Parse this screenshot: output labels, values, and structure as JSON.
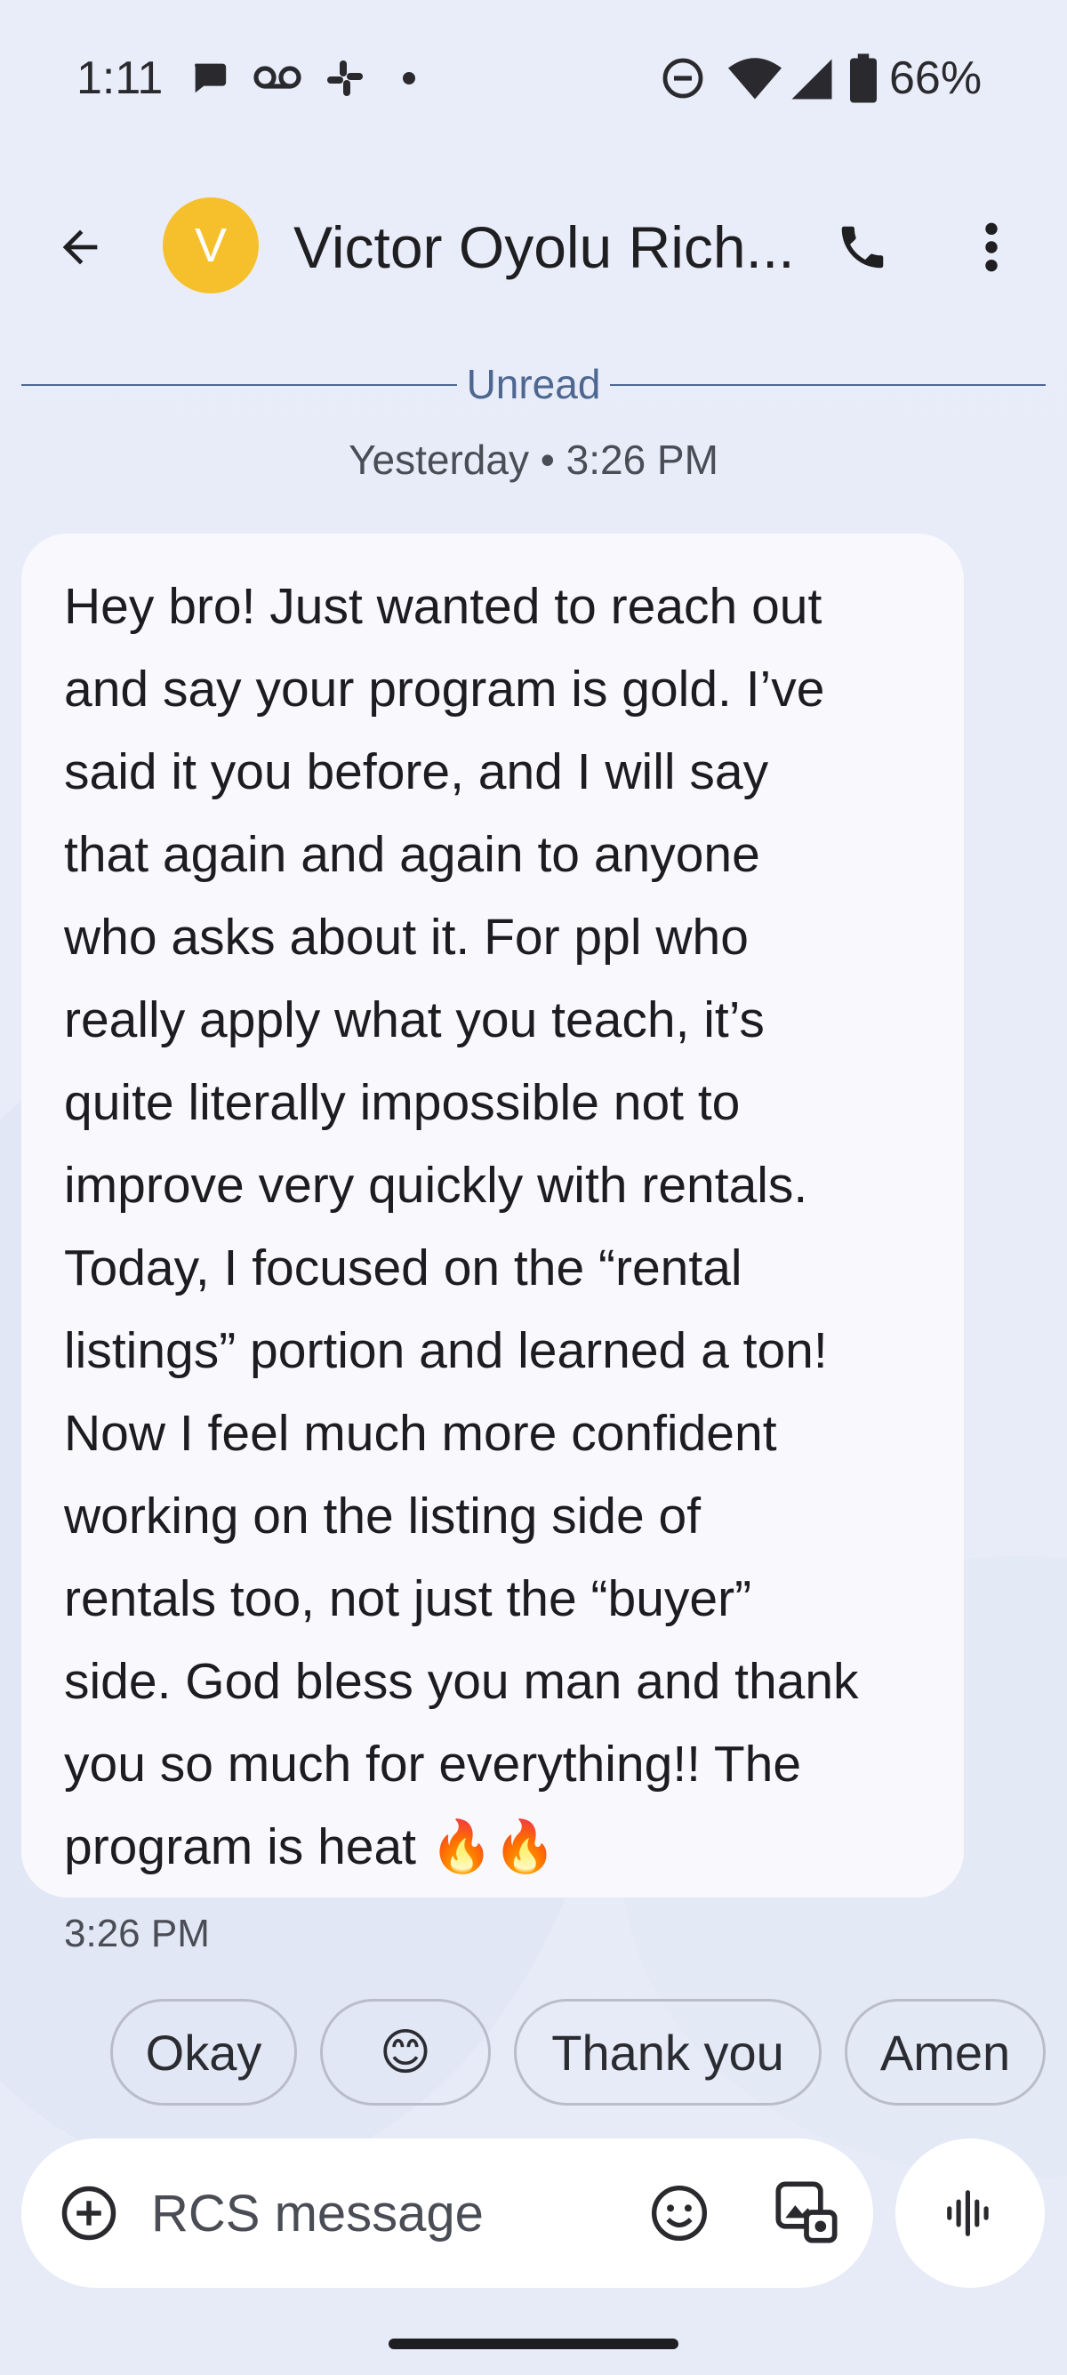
{
  "status_bar": {
    "time": "1:11",
    "battery": "66%",
    "icons": [
      "chat-bubble-icon",
      "voicemail-icon",
      "slack-icon",
      "dot-icon",
      "do-not-disturb-icon",
      "wifi-icon",
      "signal-icon",
      "battery-icon"
    ]
  },
  "header": {
    "avatar_initial": "V",
    "avatar_color": "#f6c02d",
    "contact_name": "Victor Oyolu Rich...",
    "icons": [
      "back-arrow-icon",
      "phone-icon",
      "more-vert-icon"
    ]
  },
  "thread": {
    "unread_label": "Unread",
    "date_label": "Yesterday • 3:26 PM",
    "message": {
      "text": "Hey bro! Just wanted to reach out\nand say your program is gold. I’ve\nsaid it you before, and I will say\nthat again and again to anyone\nwho asks about it. For ppl who\nreally apply what you teach, it’s\nquite literally impossible not to\nimprove very quickly with rentals.\nToday, I focused on the “rental\nlistings” portion and learned a ton!\nNow I feel much more confident\nworking on the listing side of\nrentals too, not just the “buyer”\nside. God bless you man and thank\nyou so much for everything!! The\nprogram is heat 🔥🔥",
      "time": "3:26 PM"
    }
  },
  "smart_replies": [
    "Okay",
    "😊",
    "Thank you",
    "Amen"
  ],
  "compose": {
    "placeholder": "RCS message",
    "icons": [
      "add-circle-icon",
      "emoji-icon",
      "gallery-icon",
      "voice-waveform-icon"
    ]
  }
}
